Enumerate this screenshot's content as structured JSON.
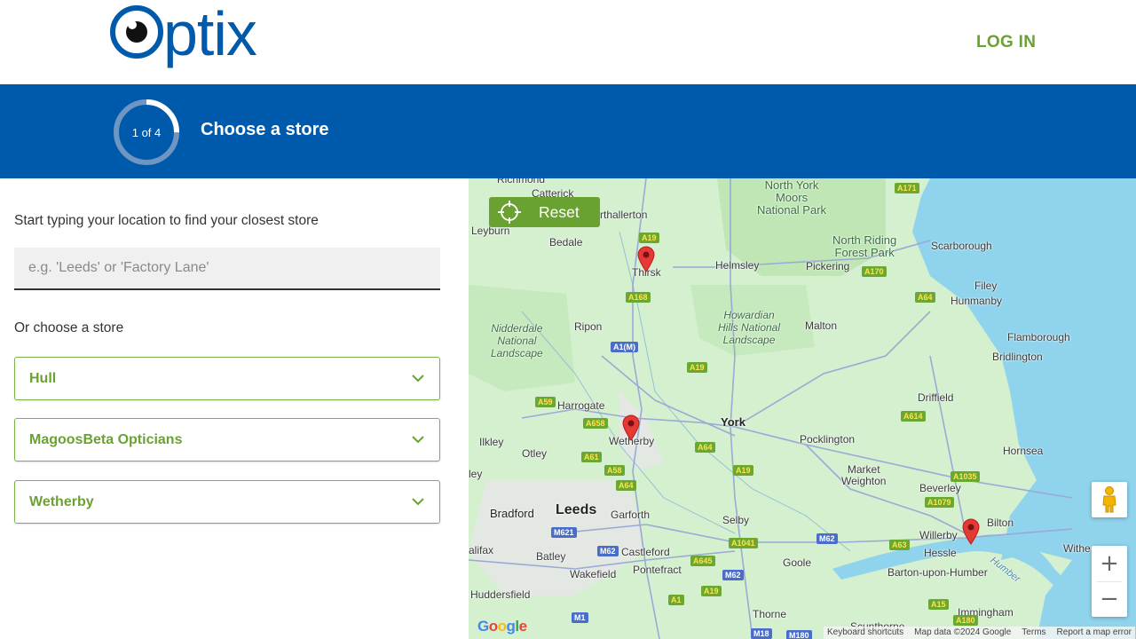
{
  "header": {
    "logo_text": "Optix",
    "login_label": "LOG IN"
  },
  "banner": {
    "step_label": "1 of 4",
    "step_progress": 0.25,
    "title": "Choose a store"
  },
  "panel": {
    "prompt": "Start typing your location to find your closest store",
    "search_placeholder": "e.g. 'Leeds' or 'Factory Lane'",
    "search_value": "",
    "or_choose_label": "Or choose a store",
    "stores": [
      {
        "name": "Hull"
      },
      {
        "name": "MagoosBeta Opticians"
      },
      {
        "name": "Wetherby"
      }
    ]
  },
  "map": {
    "reset_label": "Reset",
    "zoom_in_label": "+",
    "zoom_out_label": "−",
    "google_logo": "Google",
    "attribution": {
      "keyboard": "Keyboard shortcuts",
      "map_data": "Map data ©2024 Google",
      "terms": "Terms",
      "report": "Report a map error"
    },
    "places": [
      {
        "id": "richmond",
        "label": "Richmond"
      },
      {
        "id": "catterick",
        "label": "Catterick"
      },
      {
        "id": "northallerton",
        "label": "rthallerton"
      },
      {
        "id": "leyburn",
        "label": "Leyburn"
      },
      {
        "id": "bedale",
        "label": "Bedale"
      },
      {
        "id": "thirsk",
        "label": "Thirsk"
      },
      {
        "id": "helmsley",
        "label": "Helmsley"
      },
      {
        "id": "pickering",
        "label": "Pickering"
      },
      {
        "id": "scarborough",
        "label": "Scarborough"
      },
      {
        "id": "filey",
        "label": "Filey"
      },
      {
        "id": "hunmanby",
        "label": "Hunmanby"
      },
      {
        "id": "flamborough",
        "label": "Flamborough"
      },
      {
        "id": "bridlington",
        "label": "Bridlington"
      },
      {
        "id": "ripon",
        "label": "Ripon"
      },
      {
        "id": "malton",
        "label": "Malton"
      },
      {
        "id": "driffield",
        "label": "Driffield"
      },
      {
        "id": "harrogate",
        "label": "Harrogate"
      },
      {
        "id": "wetherby",
        "label": "Wetherby"
      },
      {
        "id": "york",
        "label": "York"
      },
      {
        "id": "pocklington",
        "label": "Pocklington"
      },
      {
        "id": "hornsea",
        "label": "Hornsea"
      },
      {
        "id": "ilkley",
        "label": "Ilkley"
      },
      {
        "id": "otley",
        "label": "Otley"
      },
      {
        "id": "market_weighton",
        "label": "Market\nWeighton"
      },
      {
        "id": "beverley",
        "label": "Beverley"
      },
      {
        "id": "bradford",
        "label": "Bradford"
      },
      {
        "id": "leeds",
        "label": "Leeds"
      },
      {
        "id": "garforth",
        "label": "Garforth"
      },
      {
        "id": "selby",
        "label": "Selby"
      },
      {
        "id": "bilton",
        "label": "Bilton"
      },
      {
        "id": "willerby",
        "label": "Willerby"
      },
      {
        "id": "hessle",
        "label": "Hessle"
      },
      {
        "id": "withernsea",
        "label": "Withe"
      },
      {
        "id": "halifax",
        "label": "alifax"
      },
      {
        "id": "batley",
        "label": "Batley"
      },
      {
        "id": "castleford",
        "label": "Castleford"
      },
      {
        "id": "goole",
        "label": "Goole"
      },
      {
        "id": "wakefield",
        "label": "Wakefield"
      },
      {
        "id": "pontefract",
        "label": "Pontefract"
      },
      {
        "id": "barton",
        "label": "Barton-upon-Humber"
      },
      {
        "id": "huddersfield",
        "label": "Huddersfield"
      },
      {
        "id": "thorne",
        "label": "Thorne"
      },
      {
        "id": "immingham",
        "label": "Immingham"
      },
      {
        "id": "scunthorpe",
        "label": "Scunthorpe"
      },
      {
        "id": "ley",
        "label": "ley"
      },
      {
        "id": "humber",
        "label": "Humber"
      }
    ],
    "parks": [
      {
        "id": "nym",
        "label": "North York\nMoors\nNational Park"
      },
      {
        "id": "nrf",
        "label": "North Riding\nForest Park"
      },
      {
        "id": "nidderdale",
        "label": "Nidderdale\nNational\nLandscape"
      },
      {
        "id": "howardian",
        "label": "Howardian\nHills National\nLandscape"
      }
    ],
    "roads": [
      "A171",
      "A19",
      "A170",
      "A168",
      "A64",
      "A1(M)",
      "A19",
      "A59",
      "A658",
      "A614",
      "A64",
      "A61",
      "A58",
      "A19",
      "A1035",
      "A64",
      "A1079",
      "M621",
      "M62",
      "A645",
      "A1041",
      "M62",
      "A63",
      "M62",
      "A19",
      "A1",
      "A15",
      "A180",
      "M1",
      "M18",
      "M180"
    ]
  },
  "colors": {
    "brand_blue": "#005aab",
    "brand_green": "#6aa232",
    "pin_red": "#e53935"
  }
}
